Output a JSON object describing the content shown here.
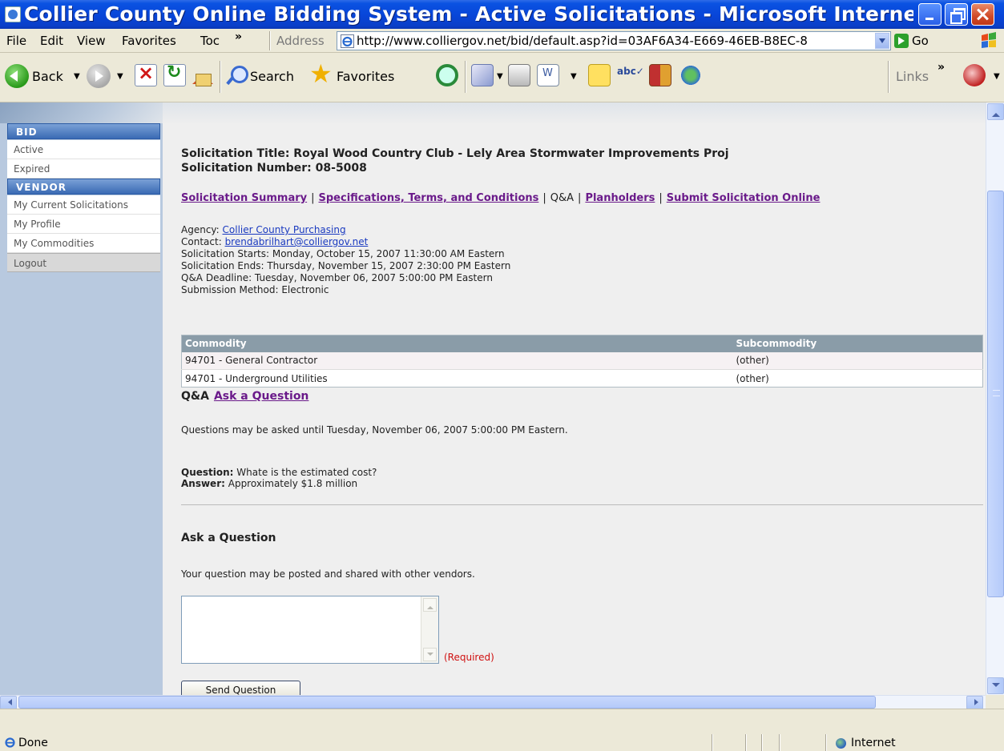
{
  "window": {
    "title": "Collier County Online Bidding System - Active Solicitations - Microsoft Internet E..."
  },
  "menu": {
    "items": [
      "File",
      "Edit",
      "View",
      "Favorites",
      "Toc"
    ],
    "chevron": "»",
    "address_label": "Address",
    "url": "http://www.colliergov.net/bid/default.asp?id=03AF6A34-E669-46EB-B8EC-8",
    "go_label": "Go"
  },
  "toolbar": {
    "back_label": "Back",
    "search_label": "Search",
    "favorites_label": "Favorites",
    "links_label": "Links",
    "chevron": "»"
  },
  "sidebar": {
    "bid_header": "BID",
    "bid_items": [
      "Active",
      "Expired"
    ],
    "vendor_header": "VENDOR",
    "vendor_items": [
      "My Current Solicitations",
      "My Profile",
      "My Commodities"
    ],
    "logout_label": "Logout"
  },
  "solicitation": {
    "title_line": "Solicitation Title: Royal Wood Country Club - Lely Area Stormwater Improvements Proj",
    "number_line": "Solicitation Number: 08-5008",
    "nav": {
      "summary": "Solicitation Summary",
      "specs": "Specifications, Terms, and Conditions",
      "qa": "Q&A",
      "planholders": "Planholders",
      "submit": "Submit Solicitation Online",
      "separator": "|"
    },
    "agency_label": "Agency:",
    "agency_value": "Collier County Purchasing",
    "contact_label": "Contact:",
    "contact_value": "brendabrilhart@colliergov.net",
    "starts": "Solicitation Starts: Monday, October 15, 2007 11:30:00 AM Eastern",
    "ends": "Solicitation Ends: Thursday, November 15, 2007 2:30:00 PM Eastern",
    "qa_deadline": "Q&A Deadline: Tuesday, November 06, 2007 5:00:00 PM Eastern",
    "submission": "Submission Method: Electronic"
  },
  "commodities": {
    "headers": [
      "Commodity",
      "Subcommodity"
    ],
    "rows": [
      [
        "94701 - General Contractor",
        "(other)"
      ],
      [
        "94701 - Underground Utilities",
        "(other)"
      ]
    ]
  },
  "qa": {
    "heading": "Q&A",
    "ask_link": "Ask a Question",
    "until": "Questions may be asked until Tuesday, November 06, 2007 5:00:00 PM Eastern.",
    "question_label": "Question:",
    "question_text": " Whate is the estimated cost?",
    "answer_label": "Answer:",
    "answer_text": " Approximately $1.8 million"
  },
  "ask": {
    "heading": "Ask a Question",
    "note": "Your question may be posted and shared with other vendors.",
    "textarea_value": "",
    "required_label": "(Required)",
    "send_label": "Send Question"
  },
  "status": {
    "text": "Done",
    "zone": "Internet"
  }
}
